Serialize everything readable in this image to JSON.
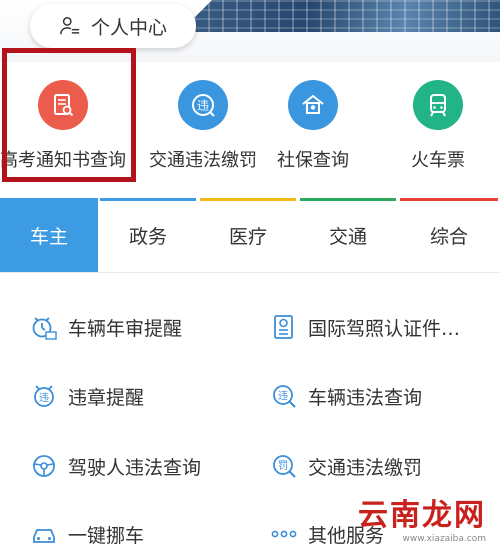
{
  "header": {
    "profile_label": "个人中心",
    "profile_icon": "user-list-icon"
  },
  "quick_services": [
    {
      "label": "高考通知书查询",
      "icon": "document-search-icon",
      "color": "#ec5c4c",
      "highlighted": true
    },
    {
      "label": "交通违法缴罚",
      "icon": "traffic-violation-icon",
      "color": "#3b96e0",
      "highlighted": false
    },
    {
      "label": "社保查询",
      "icon": "social-security-icon",
      "color": "#3b96e0",
      "highlighted": false
    },
    {
      "label": "火车票",
      "icon": "train-icon",
      "color": "#22b487",
      "highlighted": false
    }
  ],
  "tabs": [
    {
      "label": "车主",
      "active": true,
      "accent": "#3d9be3"
    },
    {
      "label": "政务",
      "active": false,
      "accent": "#3d9be3"
    },
    {
      "label": "医疗",
      "active": false,
      "accent": "#f5b915"
    },
    {
      "label": "交通",
      "active": false,
      "accent": "#2cab5c"
    },
    {
      "label": "综合",
      "active": false,
      "accent": "#e8433a"
    }
  ],
  "services": [
    {
      "label": "车辆年审提醒",
      "icon": "alarm-check-icon"
    },
    {
      "label": "国际驾照认证件…",
      "icon": "license-document-icon"
    },
    {
      "label": "违章提醒",
      "icon": "alarm-violation-icon"
    },
    {
      "label": "车辆违法查询",
      "icon": "violation-search-icon"
    },
    {
      "label": "驾驶人违法查询",
      "icon": "steering-wheel-icon"
    },
    {
      "label": "交通违法缴罚",
      "icon": "fine-payment-icon"
    },
    {
      "label": "一键挪车",
      "icon": "car-icon"
    },
    {
      "label": "其他服务",
      "icon": "more-dots-icon"
    }
  ],
  "watermark": {
    "title": "云南龙网",
    "url": "www.xiazaiba.com"
  }
}
